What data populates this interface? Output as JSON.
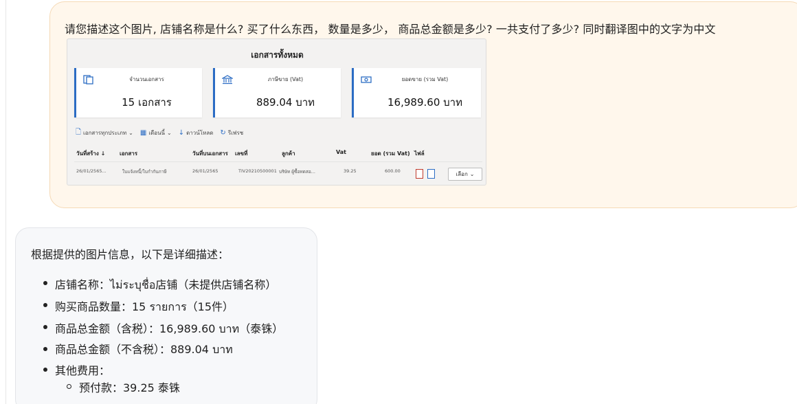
{
  "user_message": {
    "text": "请您描述这个图片, 店铺名称是什么? 买了什么东西， 数量是多少， 商品总金额是多少? 一共支付了多少? 同时翻译图中的文字为中文"
  },
  "screenshot": {
    "title": "เอกสารทั้งหมด",
    "cards": [
      {
        "label": "จำนวนเอกสาร",
        "value": "15 เอกสาร",
        "icon": "documents-icon"
      },
      {
        "label": "ภาษีขาย (Vat)",
        "value": "889.04 บาท",
        "icon": "bank-icon"
      },
      {
        "label": "ยอดขาย (รวม Vat)",
        "value": "16,989.60 บาท",
        "icon": "money-icon"
      }
    ],
    "toolbar": {
      "doc_type": "เอกสารทุกประเภท",
      "period": "เดือนนี้",
      "download": "ดาวน์โหลด",
      "refresh": "รีเฟรช"
    },
    "columns": [
      "วันที่สร้าง ↓",
      "เอกสาร",
      "วันที่บนเอกสาร",
      "เลขที่",
      "ลูกค้า",
      "Vat",
      "ยอด (รวม Vat)",
      "ไฟล์"
    ],
    "row": {
      "created": "26/01/2565...",
      "document": "ใบแจ้งหนี้/ใบกำกับภาษี",
      "doc_date": "26/01/2565",
      "number": "TIV20210500001",
      "customer": "บริษัท ผู้ซื้อทดสอ...",
      "vat": "39.25",
      "total": "600.00",
      "select_label": "เลือก"
    },
    "accent_color": "#2b6cc4"
  },
  "assistant_message": {
    "intro": "根据提供的图片信息，以下是详细描述：",
    "bullets": [
      "店铺名称：ไม่ระบุชื่อ店铺（未提供店铺名称）",
      "购买商品数量：15 รายการ（15件）",
      "商品总金额（含税）：16,989.60 บาท（泰铢）",
      "商品总金额（不含税）：889.04 บาท",
      "其他费用："
    ],
    "sub_bullets": [
      "预付款：39.25 泰铢"
    ]
  }
}
